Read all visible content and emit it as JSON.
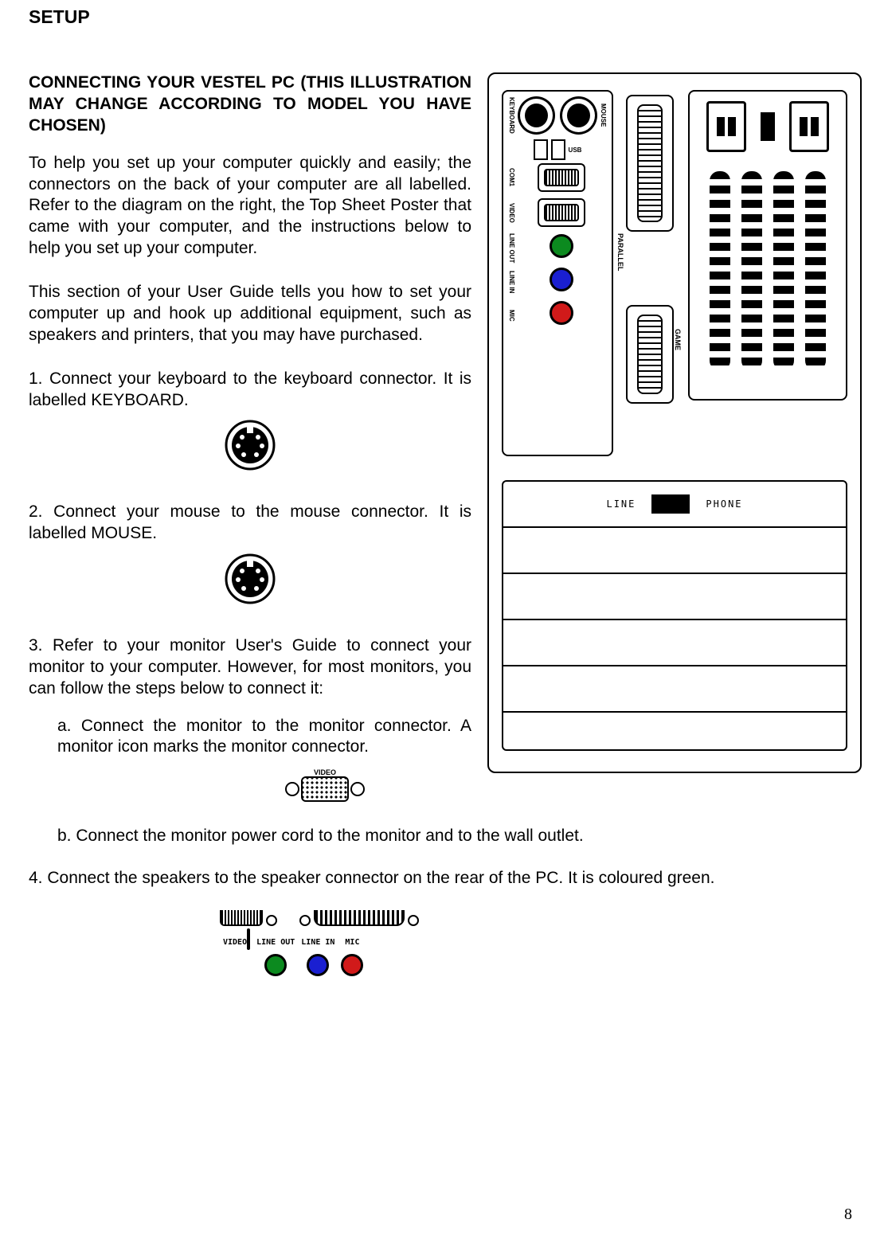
{
  "page_number": "8",
  "title": "SETUP",
  "section_heading": "CONNECTING YOUR VESTEL PC (THIS ILLUSTRATION MAY CHANGE ACCORDING TO MODEL YOU HAVE CHOSEN)",
  "intro_p1": "To help you set up your computer quickly and easily; the connectors on the back of your computer are all labelled. Refer to the diagram on the right, the Top Sheet Poster that came with your computer, and the instructions below to help you set up your computer.",
  "intro_p2": "This section of your User Guide tells you how to set your computer up and hook up additional equipment, such as speakers and printers, that you may have purchased.",
  "step1": "1. Connect your keyboard to the keyboard connector.  It is labelled KEYBOARD.",
  "step2": "2.  Connect your mouse to the mouse connector. It is labelled MOUSE.",
  "step3": "3.  Refer to your monitor User's Guide to connect your monitor to your computer. However, for most monitors, you can follow the steps below to connect it:",
  "step3a": "a. Connect the monitor to the monitor connector. A monitor icon marks the monitor connector.",
  "step3b": "b. Connect the monitor power cord to the monitor and to the wall outlet.",
  "step4": "4. Connect the speakers to the speaker connector on the rear of the PC. It is coloured green.",
  "labels": {
    "keyboard": "KEYBOARD",
    "mouse": "MOUSE",
    "usb": "USB",
    "com1": "COM1",
    "parallel": "PARALLEL",
    "video": "VIDEO",
    "game": "GAME",
    "line_out": "LINE OUT",
    "line_in": "LINE IN",
    "mic": "MIC",
    "line": "LINE",
    "phone": "PHONE"
  }
}
